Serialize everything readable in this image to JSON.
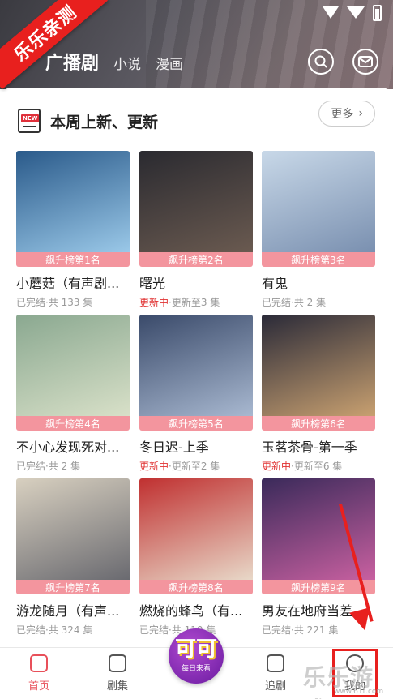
{
  "header": {
    "watermark": "乐乐亲测",
    "nav": [
      {
        "label": "广播剧",
        "active": true
      },
      {
        "label": "小说",
        "active": false
      },
      {
        "label": "漫画",
        "active": false
      }
    ],
    "search_icon": "search-icon",
    "message_icon": "mail-icon"
  },
  "section": {
    "badge": "NEW",
    "title": "本周上新、更新",
    "more_label": "更多"
  },
  "cards": [
    {
      "rank": "飙升榜第1名",
      "title": "小蘑菇（有声剧...",
      "state": "",
      "info": "已完结·共 133 集",
      "colors": [
        "#2a5a8a",
        "#9ac8e8"
      ]
    },
    {
      "rank": "飙升榜第2名",
      "title": "曙光",
      "state": "更新中",
      "info": "·更新至3 集",
      "colors": [
        "#2a2a30",
        "#6a5a50"
      ]
    },
    {
      "rank": "飙升榜第3名",
      "title": "有鬼",
      "state": "",
      "info": "已完结·共 2 集",
      "colors": [
        "#c8d8e8",
        "#7a90b0"
      ]
    },
    {
      "rank": "飙升榜第4名",
      "title": "不小心发现死对...",
      "state": "",
      "info": "已完结·共 2 集",
      "colors": [
        "#8aa890",
        "#d8e0c8"
      ]
    },
    {
      "rank": "飙升榜第5名",
      "title": "冬日迟-上季",
      "state": "更新中",
      "info": "·更新至2 集",
      "colors": [
        "#3a4a6a",
        "#a8b8d0"
      ]
    },
    {
      "rank": "飙升榜第6名",
      "title": "玉茗茶骨-第一季",
      "state": "更新中",
      "info": "·更新至6 集",
      "colors": [
        "#2a2a38",
        "#c8a070"
      ]
    },
    {
      "rank": "飙升榜第7名",
      "title": "游龙随月（有声...",
      "state": "",
      "info": "已完结·共 324 集",
      "colors": [
        "#d8d0c0",
        "#6a6a70"
      ]
    },
    {
      "rank": "飙升榜第8名",
      "title": "燃烧的蜂鸟（有...",
      "state": "",
      "info": "已完结·共 110 集",
      "colors": [
        "#c03030",
        "#e8d8c8"
      ]
    },
    {
      "rank": "飙升榜第9名",
      "title": "男友在地府当差...",
      "state": "",
      "info": "已完结·共 221 集",
      "colors": [
        "#3a2a5a",
        "#c860a0"
      ]
    }
  ],
  "bottom_nav": {
    "home": "首页",
    "series": "剧集",
    "center_big": "可可",
    "center_small": "每日来看",
    "follow": "追剧",
    "mine": "我的"
  },
  "overlay": {
    "brand": "乐乐游戏",
    "url": "www.61t.com"
  }
}
